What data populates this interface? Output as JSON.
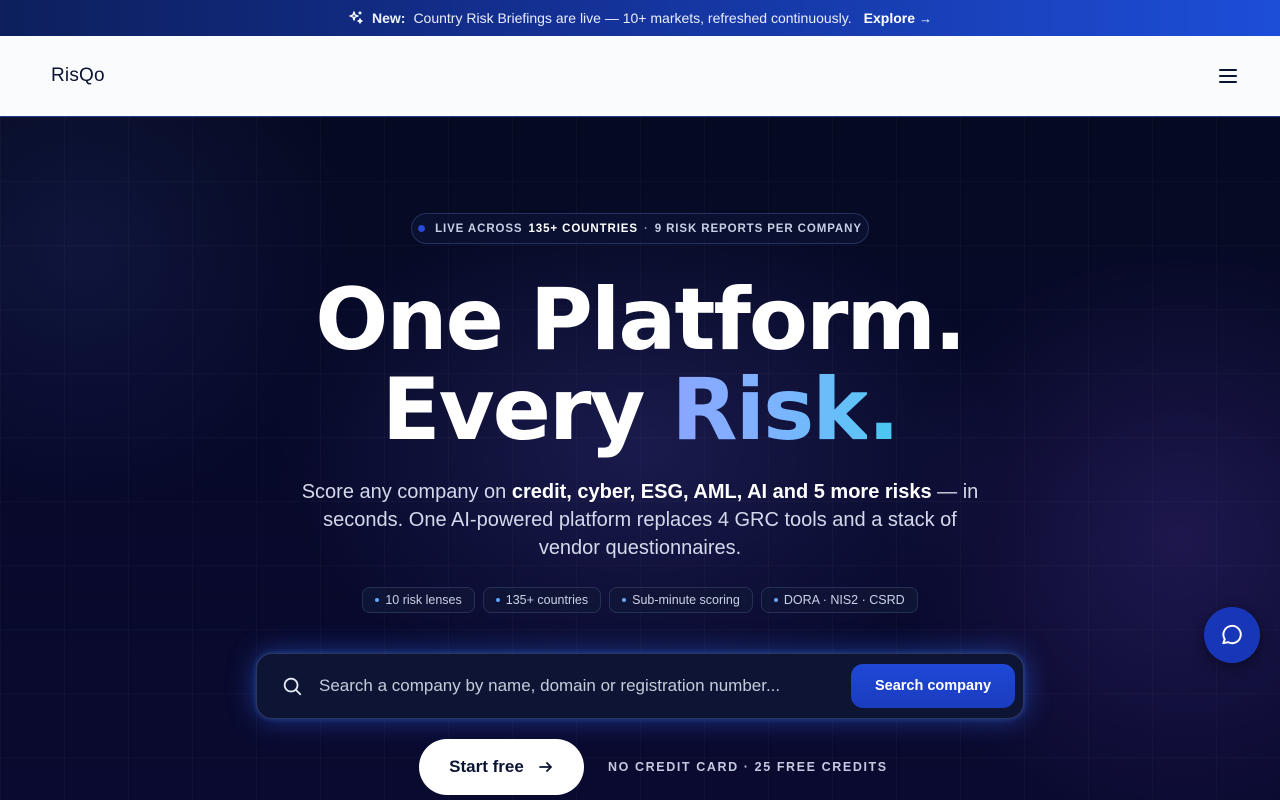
{
  "announcement": {
    "icon": "sparkle-icon",
    "new_label": "New:",
    "message": "Country Risk Briefings are live — 10+ markets, refreshed continuously.",
    "link_label": "Explore",
    "link_arrow": "→"
  },
  "nav": {
    "logo": "RisQo",
    "menu_icon": "hamburger-menu-icon"
  },
  "hero": {
    "pill": {
      "prefix": "LIVE ACROSS",
      "highlight": "135+ COUNTRIES",
      "separator": "·",
      "suffix": "9 RISK REPORTS PER COMPANY"
    },
    "headline_line1": "One Platform.",
    "headline_line2_prefix": "Every",
    "headline_line2_accent": "Risk",
    "headline_line2_period": ".",
    "sub_prefix": "Score any company on",
    "sub_bold": "credit, cyber, ESG, AML, AI and 5 more risks",
    "sub_suffix": "— in seconds. One AI-powered platform replaces 4 GRC tools and a stack of vendor questionnaires.",
    "chips": [
      "10 risk lenses",
      "135+ countries",
      "Sub-minute scoring",
      "DORA · NIS2 · CSRD"
    ],
    "search": {
      "placeholder": "Search a company by name, domain or registration number...",
      "value": "",
      "button_label": "Search company"
    },
    "start_label": "Start free",
    "start_note": "NO CREDIT CARD · 25 FREE CREDITS"
  },
  "colors": {
    "accent": "#1d4ed8",
    "background": "#05081f",
    "risk_gradient_start": "#8aa6ff",
    "risk_gradient_end": "#5cc4f5"
  },
  "chat_icon": "chat-bubble-icon"
}
